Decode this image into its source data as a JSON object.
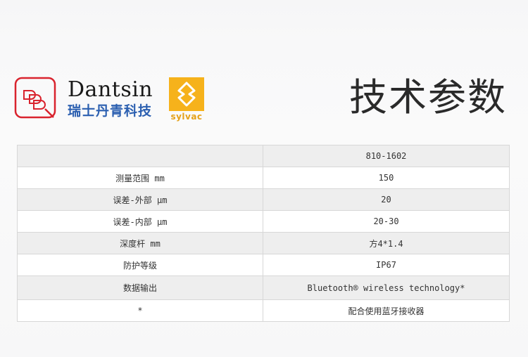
{
  "header": {
    "brand_name": "Dantsin",
    "brand_name_cn": "瑞士丹青科技",
    "partner_name": "sylvac",
    "page_title": "技术参数",
    "colors": {
      "logo_red": "#d9232e",
      "brand_blue": "#2b5fb0",
      "sylvac_yellow": "#f6b21b"
    }
  },
  "spec_table": {
    "rows": [
      {
        "label": "",
        "value": "810-1602"
      },
      {
        "label": "测量范围 mm",
        "value": "150"
      },
      {
        "label": "误差-外部 μm",
        "value": "20"
      },
      {
        "label": "误差-内部 μm",
        "value": "20-30"
      },
      {
        "label": "深度杆 mm",
        "value": "方4*1.4"
      },
      {
        "label": "防护等级",
        "value": "IP67"
      },
      {
        "label": "数据输出",
        "value": "Bluetooth® wireless technology*"
      },
      {
        "label": "*",
        "value": "配合使用蓝牙接收器"
      }
    ]
  }
}
